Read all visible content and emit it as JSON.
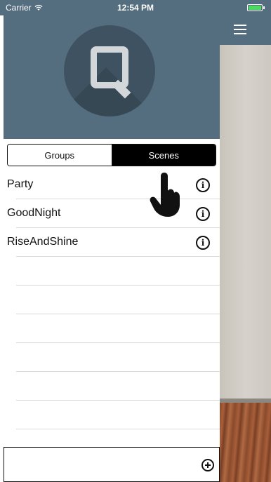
{
  "status_bar": {
    "carrier": "Carrier",
    "time": "12:54 PM",
    "wifi_icon": "wifi-icon",
    "battery_icon": "battery-icon",
    "battery_color": "#4cd964"
  },
  "header": {
    "logo_letter": "Q",
    "menu_icon": "hamburger-menu-icon",
    "background_color": "#546d7f"
  },
  "segmented_control": {
    "options": [
      {
        "label": "Groups",
        "selected": false
      },
      {
        "label": "Scenes",
        "selected": true
      }
    ]
  },
  "scenes": {
    "items": [
      {
        "label": "Party",
        "icon": "info-icon"
      },
      {
        "label": "GoodNight",
        "icon": "info-icon"
      },
      {
        "label": "RiseAndShine",
        "icon": "info-icon"
      }
    ],
    "empty_rows": 6
  },
  "footer": {
    "add_icon": "add-circle-icon"
  },
  "overlay": {
    "pointer_icon": "hand-pointer-icon"
  }
}
